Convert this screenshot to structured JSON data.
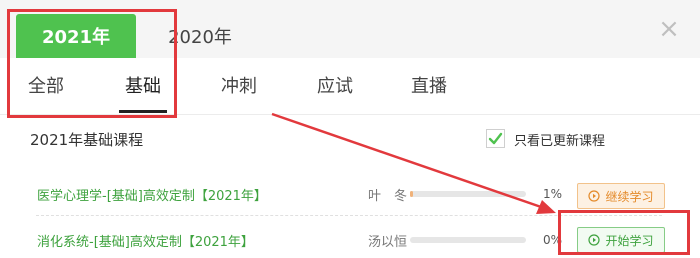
{
  "year_tabs": [
    {
      "label": "2021年",
      "active": true
    },
    {
      "label": "2020年",
      "active": false
    }
  ],
  "close_symbol": "×",
  "category_tabs": [
    {
      "label": "全部"
    },
    {
      "label": "基础",
      "active": true
    },
    {
      "label": "冲刺"
    },
    {
      "label": "应试"
    },
    {
      "label": "直播"
    }
  ],
  "section_title": "2021年基础课程",
  "filter": {
    "label": "只看已更新课程",
    "checked": true
  },
  "courses": [
    {
      "name": "医学心理学-[基础]高效定制【2021年】",
      "teacher": "叶　冬",
      "progress_text": "1%",
      "progress": 0.01,
      "action": "继续学习"
    },
    {
      "name": "消化系统-[基础]高效定制【2021年】",
      "teacher": "汤以恒",
      "progress_text": "0%",
      "progress": 0.0,
      "action": "开始学习"
    }
  ],
  "colors": {
    "accent_green": "#4fc24f",
    "link_green": "#3ea23e",
    "continue_orange": "#e48a2a",
    "annotation_red": "#e2393d"
  },
  "icons": {
    "close": "close-icon",
    "check": "check-icon",
    "play": "play-circle-icon",
    "annotation": "arrow-annotation"
  }
}
